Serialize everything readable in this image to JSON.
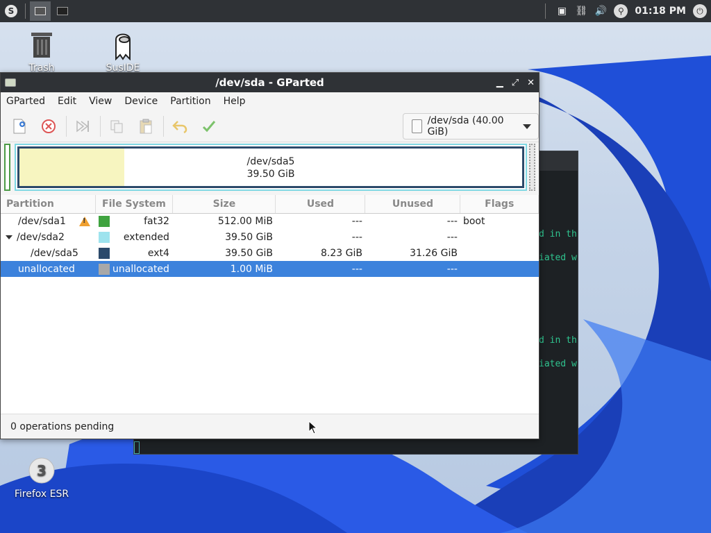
{
  "panel": {
    "clock": "01:18 PM",
    "start_icon": "distro-logo-icon",
    "tray_icons": [
      "screen-icon",
      "link-icon",
      "volume-icon",
      "search-icon",
      "power-icon"
    ]
  },
  "desktop": {
    "icons": [
      {
        "label": "Trash",
        "icon": "trash-icon"
      },
      {
        "label": "SusIDE",
        "icon": "susid-icon"
      },
      {
        "label": "Firefox ESR",
        "icon": "firefox-icon"
      }
    ]
  },
  "terminal": {
    "lines": [
      "d in th",
      "iated w",
      "d in th",
      "iated w"
    ]
  },
  "window": {
    "title": "/dev/sda - GParted",
    "menu": [
      "GParted",
      "Edit",
      "View",
      "Device",
      "Partition",
      "Help"
    ],
    "device_selector": "/dev/sda (40.00 GiB)",
    "disk_map": {
      "name": "/dev/sda5",
      "size": "39.50 GiB",
      "used_fraction": 0.208
    },
    "columns": [
      "Partition",
      "File System",
      "Size",
      "Used",
      "Unused",
      "Flags"
    ],
    "rows": [
      {
        "partition": "/dev/sda1",
        "fs": "fat32",
        "fs_color": "#3fa33f",
        "size": "512.00 MiB",
        "used": "---",
        "unused": "---",
        "flags": "boot",
        "warn": true
      },
      {
        "partition": "/dev/sda2",
        "fs": "extended",
        "fs_color": "#9ee3ee",
        "size": "39.50 GiB",
        "used": "---",
        "unused": "---",
        "flags": ""
      },
      {
        "partition": "/dev/sda5",
        "fs": "ext4",
        "fs_color": "#2c4a6b",
        "size": "39.50 GiB",
        "used": "8.23 GiB",
        "unused": "31.26 GiB",
        "flags": ""
      },
      {
        "partition": "unallocated",
        "fs": "unallocated",
        "fs_color": "#a8a8a8",
        "size": "1.00 MiB",
        "used": "---",
        "unused": "---",
        "flags": ""
      }
    ],
    "status": "0 operations pending"
  }
}
